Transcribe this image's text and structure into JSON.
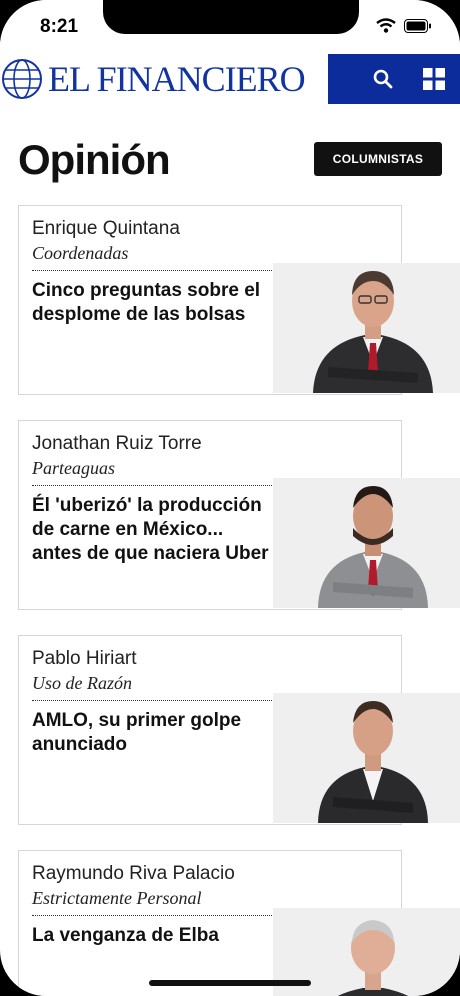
{
  "status_bar": {
    "time": "8:21"
  },
  "header": {
    "logo": "EL FINANCIERO",
    "search_icon": "search-icon",
    "menu_icon": "grid-menu-icon",
    "brand_color": "#0c2c9b"
  },
  "page": {
    "title": "Opinión",
    "columnists_button": "COLUMNISTAS"
  },
  "articles": [
    {
      "author": "Enrique Quintana",
      "column": "Coordenadas",
      "headline": "Cinco preguntas sobre el desplome de las bolsas"
    },
    {
      "author": "Jonathan Ruiz Torre",
      "column": "Parteaguas",
      "headline": "Él 'uberizó' la producción de carne en México... antes de que naciera Uber"
    },
    {
      "author": "Pablo Hiriart",
      "column": "Uso de Razón",
      "headline": "AMLO, su primer golpe anunciado"
    },
    {
      "author": "Raymundo Riva Palacio",
      "column": "Estrictamente Personal",
      "headline": "La venganza de Elba"
    }
  ]
}
